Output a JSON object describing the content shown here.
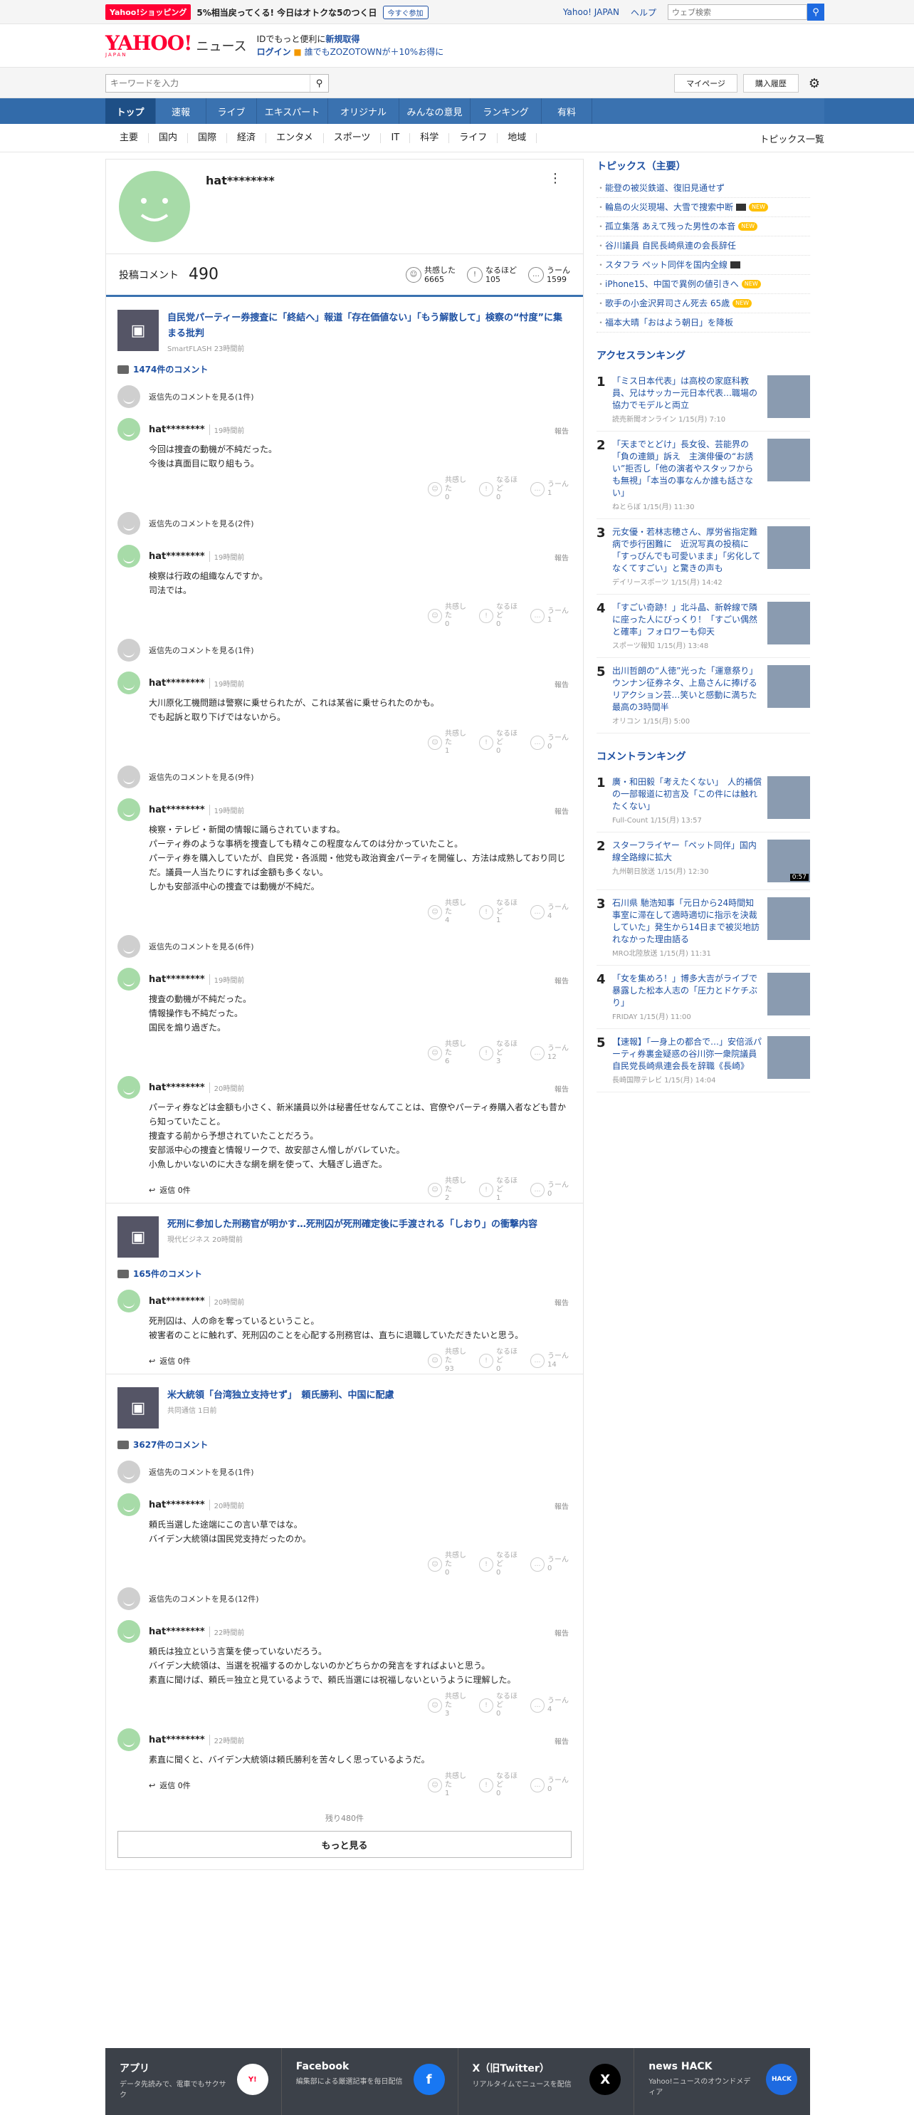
{
  "topstrip": {
    "shop_badge": "Yahoo!ショッピング",
    "promo": "5%相当戻ってくる! 今日はオトクな5のつく日",
    "promo_btn": "今すぐ参加",
    "links": [
      "Yahoo! JAPAN",
      "ヘルプ"
    ],
    "search_placeholder": "ウェブ検索"
  },
  "header": {
    "logo": "YAHOO!",
    "logo_sub": "JAPAN",
    "section": "ニュース",
    "login_line1_pre": "IDでもっと便利に",
    "login_line1_link": "新規取得",
    "login_line2_link": "ログイン",
    "login_line2_rest": "誰でもZOZOTOWNが＋10%お得に"
  },
  "searchbar": {
    "placeholder": "キーワードを入力",
    "mypage": "マイページ",
    "history": "購入履歴"
  },
  "nav": {
    "tabs": [
      "トップ",
      "速報",
      "ライブ",
      "エキスパート",
      "オリジナル",
      "みんなの意見",
      "ランキング",
      "有料"
    ]
  },
  "subnav": {
    "items": [
      "主要",
      "国内",
      "国際",
      "経済",
      "エンタメ",
      "スポーツ",
      "IT",
      "科学",
      "ライフ",
      "地域"
    ],
    "all": "トピックス一覧"
  },
  "profile": {
    "name": "hat********",
    "comments_label": "投稿コメント",
    "comments_count": "490",
    "reactions": [
      {
        "label": "共感した",
        "count": "6665"
      },
      {
        "label": "なるほど",
        "count": "105"
      },
      {
        "label": "うーん",
        "count": "1599"
      }
    ]
  },
  "vote_labels": [
    "共感した",
    "なるほど",
    "うーん"
  ],
  "articles": [
    {
      "title": "自民党パーティー券捜査に「終結へ」報道「存在価値ない」「もう解散して」検察の“忖度”に集まる批判",
      "source": "SmartFLASH 23時間前",
      "comment_count": "1474件のコメント",
      "comments": [
        {
          "reply_link": "返信先のコメントを見る(1件)",
          "name": "hat********",
          "time": "19時間前",
          "report": "報告",
          "lines": [
            "今回は捜査の動機が不純だった。",
            "今後は真面目に取り組もう。"
          ],
          "votes": [
            "0",
            "0",
            "1"
          ]
        },
        {
          "reply_link": "返信先のコメントを見る(2件)",
          "name": "hat********",
          "time": "19時間前",
          "report": "報告",
          "lines": [
            "検察は行政の組織なんですか。",
            "司法では。"
          ],
          "votes": [
            "0",
            "0",
            "1"
          ]
        },
        {
          "reply_link": "返信先のコメントを見る(1件)",
          "name": "hat********",
          "time": "19時間前",
          "report": "報告",
          "lines": [
            "大川原化工機問題は警察に乗せられたが、これは某省に乗せられたのかも。",
            "でも起訴と取り下げではないから。"
          ],
          "votes": [
            "1",
            "0",
            "0"
          ]
        },
        {
          "reply_link": "返信先のコメントを見る(9件)",
          "name": "hat********",
          "time": "19時間前",
          "report": "報告",
          "lines": [
            "検察・テレビ・新聞の情報に踊らされていますね。",
            "パーティ券のような事柄を捜査しても精々この程度なんてのは分かっていたこと。",
            "パーティ券を購入していたが、自民党・各派閥・他党も政治資金パーティを開催し、方法は成熟しており同じだ。議員一人当たりにすれば金額も多くない。",
            "しかも安部派中心の捜査では動機が不純だ。"
          ],
          "votes": [
            "4",
            "1",
            "4"
          ]
        },
        {
          "reply_link": "返信先のコメントを見る(6件)",
          "name": "hat********",
          "time": "19時間前",
          "report": "報告",
          "lines": [
            "捜査の動機が不純だった。",
            "情報操作も不純だった。",
            "国民を煽り過ぎた。"
          ],
          "votes": [
            "6",
            "3",
            "12"
          ]
        },
        {
          "reply_link": "",
          "name": "hat********",
          "time": "20時間前",
          "report": "報告",
          "lines": [
            "パーティ券などは金額も小さく、新米議員以外は秘書任せなんてことは、官僚やパーティ券購入者なども昔から知っていたこと。",
            "捜査する前から予想されていたことだろう。",
            "安部派中心の捜査と情報リークで、故安部さん憎しがバレていた。",
            "小魚しかいないのに大きな網を網を使って、大騒ぎし過ぎた。"
          ],
          "reply_btn": "返信 0件",
          "votes": [
            "2",
            "1",
            "0"
          ]
        }
      ]
    },
    {
      "title": "死刑に参加した刑務官が明かす…死刑囚が死刑確定後に手渡される「しおり」の衝撃内容",
      "source": "現代ビジネス 20時間前",
      "comment_count": "165件のコメント",
      "comments": [
        {
          "reply_link": "",
          "name": "hat********",
          "time": "20時間前",
          "report": "報告",
          "lines": [
            "死刑囚は、人の命を奪っているということ。",
            "被害者のことに触れず、死刑囚のことを心配する刑務官は、直ちに退職していただきたいと思う。"
          ],
          "reply_btn": "返信 0件",
          "votes": [
            "93",
            "0",
            "14"
          ]
        }
      ]
    },
    {
      "title": "米大統領「台湾独立支持せず」　頼氏勝利、中国に配慮",
      "source": "共同通信 1日前",
      "comment_count": "3627件のコメント",
      "comments": [
        {
          "reply_link": "返信先のコメントを見る(1件)",
          "name": "hat********",
          "time": "20時間前",
          "report": "報告",
          "lines": [
            "頼氏当選した途端にこの言い草ではな。",
            "バイデン大統領は国民党支持だったのか。"
          ],
          "votes": [
            "0",
            "0",
            "0"
          ]
        },
        {
          "reply_link": "返信先のコメントを見る(12件)",
          "name": "hat********",
          "time": "22時間前",
          "report": "報告",
          "lines": [
            "頼氏は独立という言葉を使っていないだろう。",
            "バイデン大統領は、当選を祝福するのかしないのかどちらかの発言をすればよいと思う。",
            "素直に聞けば、頼氏＝独立と見ているようで、頼氏当選には祝福しないというように理解した。"
          ],
          "votes": [
            "3",
            "0",
            "4"
          ]
        },
        {
          "reply_link": "",
          "name": "hat********",
          "time": "22時間前",
          "report": "報告",
          "lines": [
            "素直に聞くと、バイデン大統領は頼氏勝利を苦々しく思っているようだ。"
          ],
          "reply_btn": "返信 0件",
          "votes": [
            "1",
            "0",
            "0"
          ]
        }
      ]
    }
  ],
  "remaining": "残り480件",
  "more": "もっと見る",
  "sidebar": {
    "topics_title": "トピックス（主要）",
    "topics": [
      {
        "t": "能登の被災鉄道、復旧見通せず"
      },
      {
        "t": "輪島の火災現場、大雪で捜索中断",
        "v": true,
        "new": "NEW"
      },
      {
        "t": "孤立集落 あえて残った男性の本音",
        "new": "NEW"
      },
      {
        "t": "谷川議員 自民長崎県連の会長辞任"
      },
      {
        "t": "スタフラ ペット同伴を国内全線",
        "v": true
      },
      {
        "t": "iPhone15、中国で異例の値引きへ",
        "new": "NEW"
      },
      {
        "t": "歌手の小金沢昇司さん死去 65歳",
        "new": "NEW"
      },
      {
        "t": "福本大晴「おはよう朝日」を降板"
      }
    ],
    "access_title": "アクセスランキング",
    "access": [
      {
        "no": "1",
        "t": "「ミス日本代表」は高校の家庭科教員、兄はサッカー元日本代表…職場の協力でモデルと両立",
        "s": "読売新聞オンライン 1/15(月) 7:10"
      },
      {
        "no": "2",
        "t": "「天までとどけ」長女役、芸能界の「負の連鎖」訴え　主演俳優の“お誘い”拒否し「他の演者やスタッフからも無視」「本当の事なんか誰も話さない」",
        "s": "ねとらぼ 1/15(月) 11:30"
      },
      {
        "no": "3",
        "t": "元女優・若林志穂さん、厚労省指定難病で歩行困難に　近況写真の投稿に「すっぴんでも可愛いまま」「劣化してなくてすごい」と驚きの声も",
        "s": "デイリースポーツ 1/15(月) 14:42"
      },
      {
        "no": "4",
        "t": "「すごい奇跡！」北斗晶、新幹線で隣に座った人にびっくり！「すごい偶然と確率」フォロワーも仰天",
        "s": "スポーツ報知 1/15(月) 13:48"
      },
      {
        "no": "5",
        "t": "出川哲朗の“人徳”光った「運意祭り」　ウンナン征券ネタ、上島さんに捧げるリアクション芸…笑いと感動に満ちた最高の3時間半",
        "s": "オリコン 1/15(月) 5:00"
      }
    ],
    "comment_title": "コメントランキング",
    "comment": [
      {
        "no": "1",
        "t": "廣・和田毅「考えたくない」　人的補償の一部報道に初言及「この件には触れたくない」",
        "s": "Full-Count 1/15(月) 13:57"
      },
      {
        "no": "2",
        "t": "スターフライヤー「ペット同伴」国内線全路線に拡大",
        "s": "九州朝日放送 1/15(月) 12:30",
        "dur": "0:57"
      },
      {
        "no": "3",
        "t": "石川県 馳浩知事「元日から24時間知事室に滞在して適時適切に指示を決裁していた」発生から14日まで被災地訪れなかった理由語る",
        "s": "MRO北陸放送 1/15(月) 11:31"
      },
      {
        "no": "4",
        "t": "「女を集めろ！」博多大吉がライブで暴露した松本人志の「圧力とドケチぶり」",
        "s": "FRIDAY 1/15(月) 11:00"
      },
      {
        "no": "5",
        "t": "【速報】「一身上の都合で…」安倍派パーティ券裏金疑惑の谷川弥一衆院議員 自民党長崎県連会長を辞職《長崎》",
        "s": "長崎国際テレビ 1/15(月) 14:04"
      }
    ]
  },
  "footer": [
    {
      "t": "アプリ",
      "d": "データ先読みで、電車でもサクサク"
    },
    {
      "t": "Facebook",
      "d": "編集部による厳選記事を毎日配信"
    },
    {
      "t": "X（旧Twitter）",
      "d": "リアルタイムでニュースを配信"
    },
    {
      "t": "news HACK",
      "d": "Yahoo!ニュースのオウンドメディア"
    }
  ],
  "colors": {
    "accent": "#1e50a2",
    "nav": "#3a72b0",
    "brand": "#ff0033",
    "avatar": "#a7dba8"
  }
}
